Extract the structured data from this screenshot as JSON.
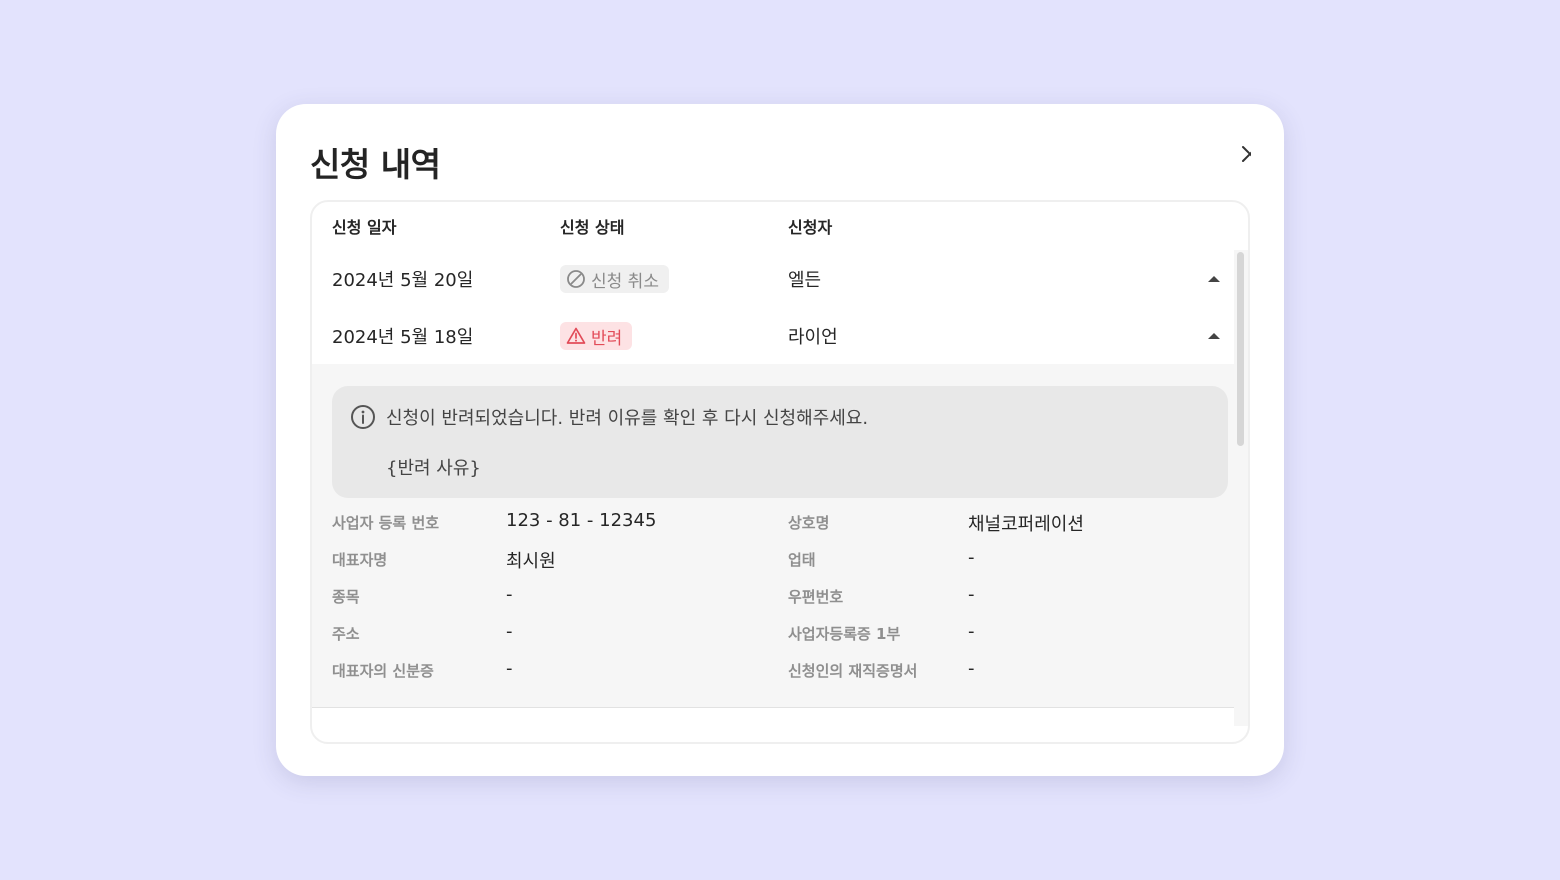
{
  "modal": {
    "title": "신청 내역"
  },
  "table": {
    "headers": {
      "date": "신청 일자",
      "status": "신청 상태",
      "applicant": "신청자"
    },
    "rows": [
      {
        "date": "2024년 5월 20일",
        "status": "신청 취소",
        "status_type": "cancelled",
        "applicant": "엘든",
        "expanded": false
      },
      {
        "date": "2024년 5월 18일",
        "status": "반려",
        "status_type": "rejected",
        "applicant": "라이언",
        "expanded": true
      }
    ]
  },
  "detail": {
    "notice_message": "신청이 반려되었습니다. 반려 이유를 확인 후 다시 신청해주세요.",
    "rejection_reason": "{반려 사유}",
    "fields": {
      "business_number_label": "사업자 등록 번호",
      "business_number": "123 - 81 - 12345",
      "company_name_label": "상호명",
      "company_name": "채널코퍼레이션",
      "representative_label": "대표자명",
      "representative": "최시원",
      "business_type_label": "업태",
      "business_type": "-",
      "business_item_label": "종목",
      "business_item": "-",
      "postal_code_label": "우편번호",
      "postal_code": "-",
      "address_label": "주소",
      "address": "-",
      "registration_cert_label": "사업자등록증 1부",
      "registration_cert": "-",
      "rep_id_label": "대표자의 신분증",
      "rep_id": "-",
      "employment_cert_label": "신청인의 재직증명서",
      "employment_cert": "-"
    }
  },
  "colors": {
    "background": "#e3e3fd",
    "rejected": "#e24b58",
    "rejected_bg": "#fde2e4",
    "cancelled": "#8a8a8a",
    "cancelled_bg": "#f0f0f0"
  },
  "icons": {
    "close": "close-icon",
    "cancelled": "prohibited-icon",
    "rejected": "warning-triangle-icon",
    "row_toggle": "caret-up-icon",
    "notice": "info-icon"
  }
}
